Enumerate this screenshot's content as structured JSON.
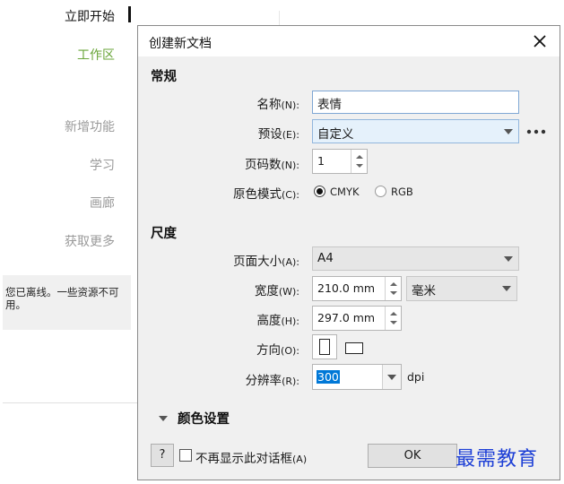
{
  "sidebar": {
    "items": [
      {
        "label": "立即开始"
      },
      {
        "label": "工作区"
      },
      {
        "label": "新增功能"
      },
      {
        "label": "学习"
      },
      {
        "label": "画廊"
      },
      {
        "label": "获取更多"
      }
    ],
    "offline_notice": "您已离线。一些资源不可用。"
  },
  "dialog": {
    "title": "创建新文档",
    "sections": {
      "general": "常规",
      "dimensions": "尺度",
      "color_settings": "颜色设置"
    },
    "fields": {
      "name": {
        "label": "名称",
        "hotkey": "(N):",
        "value": "表情"
      },
      "preset": {
        "label": "预设",
        "hotkey": "(E):",
        "value": "自定义"
      },
      "pages": {
        "label": "页码数",
        "hotkey": "(N):",
        "value": "1"
      },
      "color_mode": {
        "label": "原色模式",
        "hotkey": "(C):",
        "options": [
          "CMYK",
          "RGB"
        ],
        "selected": "CMYK"
      },
      "page_size": {
        "label": "页面大小",
        "hotkey": "(A):",
        "value": "A4"
      },
      "width": {
        "label": "宽度",
        "hotkey": "(W):",
        "value": "210.0 mm",
        "unit": "毫米"
      },
      "height": {
        "label": "高度",
        "hotkey": "(H):",
        "value": "297.0 mm"
      },
      "orientation": {
        "label": "方向",
        "hotkey": "(O):"
      },
      "resolution": {
        "label": "分辨率",
        "hotkey": "(R):",
        "value": "300",
        "unit": "dpi"
      }
    },
    "help_label": "?",
    "dont_show": {
      "label": "不再显示此对话框",
      "hotkey": "(A)"
    },
    "ok_label": "OK",
    "more_icon": "ellipsis-icon",
    "close_icon": "close-icon"
  },
  "watermark": "最需教育",
  "colors": {
    "accent_green": "#6aa63a",
    "watermark_blue": "#1d3fd6",
    "selection_blue": "#0078d7"
  }
}
